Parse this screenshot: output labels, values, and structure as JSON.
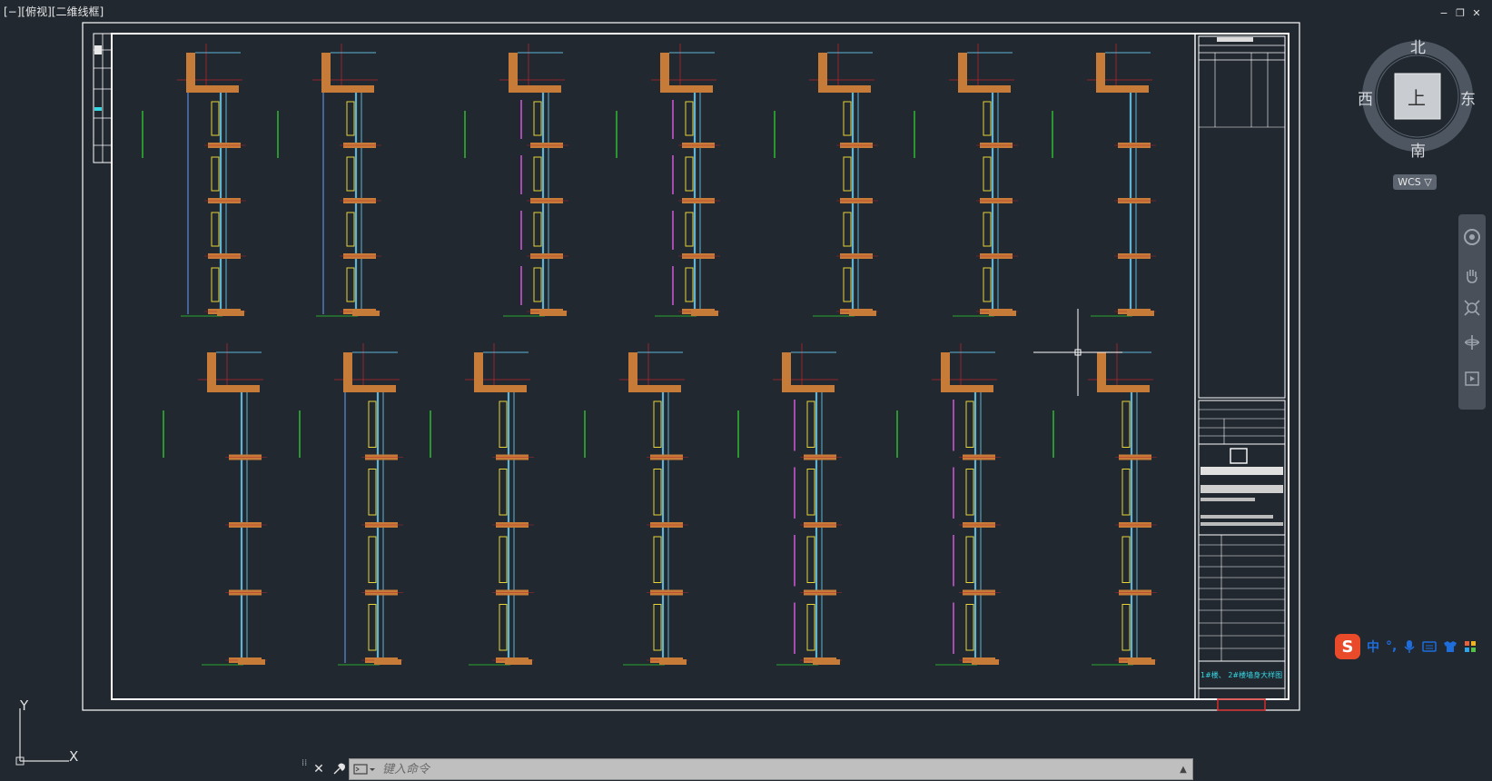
{
  "viewport": {
    "label": "[−][俯视][二维线框]"
  },
  "window_controls": {
    "minimize": "−",
    "restore": "❐",
    "close": "✕"
  },
  "viewcube": {
    "north": "北",
    "south": "南",
    "east": "东",
    "west": "西",
    "face": "上",
    "wcs": "WCS ▽"
  },
  "ime": {
    "logo": "S",
    "mode": "中",
    "punct": "°,"
  },
  "ucs": {
    "x_label": "X",
    "y_label": "Y"
  },
  "command_line": {
    "placeholder": "键入命令"
  },
  "title_block": {
    "drawing_name": "1#楼、 2#楼墙身大样图"
  },
  "colors": {
    "background": "#212830",
    "frame": "#ffffff",
    "concrete": "#c77b38",
    "glass": "#5fb4d4",
    "frame_line": "#5d8cd8",
    "yellow": "#e6d53a",
    "green": "#2fd12f",
    "red_axis": "#b7242c",
    "magenta": "#a64bb0",
    "cyan_text": "#35d9e6"
  }
}
